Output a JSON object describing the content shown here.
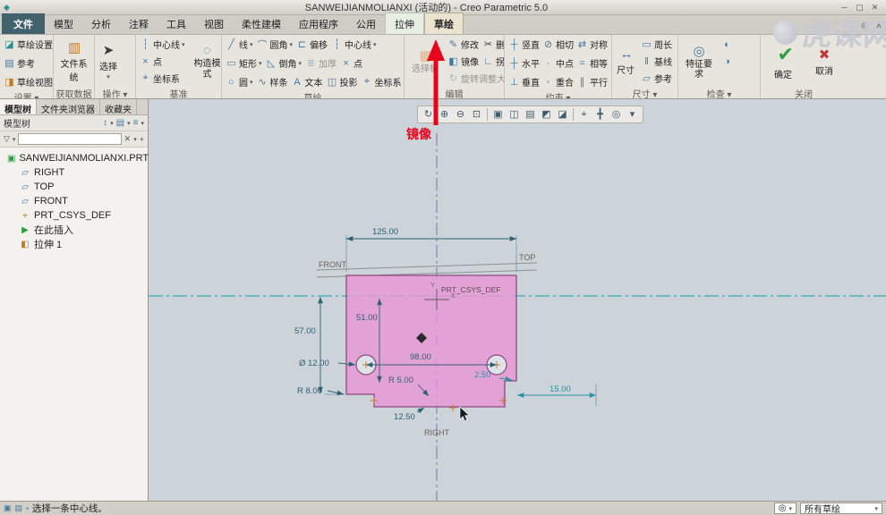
{
  "window": {
    "title": "SANWEIJIANMOLIANXI (活动的) - Creo Parametric 5.0",
    "minimize": "─",
    "maximize": "▢",
    "close": "✕",
    "watermark_text": "虎课网"
  },
  "tabs": {
    "file": "文件",
    "model": "模型",
    "analysis": "分析",
    "annotate": "注释",
    "tools": "工具",
    "view": "视图",
    "flexible": "柔性建模",
    "applications": "应用程序",
    "common": "公用",
    "extrude": "拉伸",
    "sketch": "草绘"
  },
  "ribbon": {
    "setup": {
      "label": "设置 ▾",
      "sketch_setup": "草绘设置",
      "references": "参考",
      "sketch_view": "草绘视图"
    },
    "get_data": {
      "label": "获取数据",
      "file_system": "文件系统"
    },
    "operations": {
      "label": "操作 ▾",
      "select": "选择"
    },
    "datum": {
      "label": "基准",
      "centerline": "中心线",
      "point": "点",
      "csys": "坐标系",
      "construction_mode": "构造模式"
    },
    "sketch": {
      "label": "草绘",
      "line": "线",
      "fillet": "圆角",
      "offset": "偏移",
      "centerline": "中心线",
      "rectangle": "矩形",
      "chamfer": "倒角",
      "thicken": "加厚",
      "point": "点",
      "circle": "圆",
      "spline": "样条",
      "text": "文本",
      "project": "投影",
      "csys": "坐标系"
    },
    "editing": {
      "label": "编辑",
      "palette": "选择板",
      "modify": "修改",
      "delete_segment": "删除段",
      "mirror": "镜像",
      "corner": "拐角",
      "rotate_resize": "旋转调整大小"
    },
    "constrain": {
      "label": "约束 ▾",
      "vertical": "竖直",
      "tangent": "相切",
      "symmetric": "对称",
      "horizontal": "水平",
      "midpoint": "中点",
      "equal": "相等",
      "perpendicular": "垂直",
      "coincident": "重合",
      "parallel": "平行"
    },
    "dimension": {
      "label": "尺寸 ▾",
      "dimension": "尺寸",
      "perimeter": "周长",
      "baseline": "基线",
      "reference": "参考"
    },
    "inspect": {
      "label": "检查 ▾",
      "feature_requirements": "特征要求"
    },
    "close": {
      "label": "关闭",
      "ok": "确定",
      "cancel": "取消"
    }
  },
  "sidebar": {
    "tab_model_tree": "模型树",
    "tab_folder_browser": "文件夹浏览器",
    "tab_favorites": "收藏夹",
    "tree_title": "模型树",
    "items": [
      {
        "label": "SANWEIJIANMOLIANXI.PRT",
        "icon": "part"
      },
      {
        "label": "RIGHT",
        "icon": "plane"
      },
      {
        "label": "TOP",
        "icon": "plane"
      },
      {
        "label": "FRONT",
        "icon": "plane"
      },
      {
        "label": "PRT_CSYS_DEF",
        "icon": "csys"
      },
      {
        "label": "在此插入",
        "icon": "insert"
      },
      {
        "label": "拉伸 1",
        "icon": "extrude"
      }
    ]
  },
  "canvas": {
    "annotation_mirror": "镜像",
    "labels": {
      "front": "FRONT",
      "top": "TOP",
      "right": "RIGHT",
      "csys": "PRT_CSYS_DEF",
      "axis_y": "Y",
      "axis_x": "X"
    },
    "dims": {
      "width": "125.00",
      "height": "57.00",
      "inner_height": "51.00",
      "hole_dia": "Ø 12.00",
      "hole_span": "98.00",
      "corner_radius": "R 8.00",
      "slot_radius": "R 5.00",
      "step": "2.50",
      "edge_offset": "15.00",
      "notch": "12.50"
    }
  },
  "statusbar": {
    "message": "选择一条中心线。",
    "filter_label": "所有草绘"
  },
  "colors": {
    "annotation": "#e8001c",
    "sketch_fill": "#e897d5",
    "sketch_edge": "#8d4a7e",
    "centerline": "#14a2aa",
    "mirror_line": "#7d74a8",
    "dimension": "#2e6072",
    "dimension_weak": "#2a93a3"
  },
  "toolbar_glyphs": [
    "↻",
    "⊕",
    "⊖",
    "⊡",
    "▣",
    "◫",
    "▤",
    "◩",
    "◪",
    "⌖",
    "╋",
    "◎",
    "▾"
  ],
  "glyphs": {
    "app": "◆",
    "search": "◎",
    "collapse": "∧",
    "caret": "▾",
    "sketch_setup": "◪",
    "references": "▤",
    "sketch_view": "◨",
    "file_system": "▥",
    "select": "➤",
    "centerline": "┆",
    "point": "×",
    "csys": "⌖",
    "construction_mode": "◌",
    "line": "╱",
    "fillet": "⌒",
    "offset": "⊏",
    "rectangle": "▭",
    "chamfer": "◺",
    "thicken": "≣",
    "circle": "○",
    "spline": "∿",
    "text": "A",
    "project": "◫",
    "palette": "▦",
    "modify": "✎",
    "delete_segment": "✂",
    "mirror": "◧",
    "corner": "∟",
    "rotate_resize": "↻",
    "vertical": "┼",
    "tangent": "⊘",
    "symmetric": "⇄",
    "horizontal": "┼",
    "midpoint": "∙",
    "equal": "=",
    "perpendicular": "⊥",
    "coincident": "◦",
    "parallel": "∥",
    "dimension": "↔",
    "perimeter": "▭",
    "baseline": "‖",
    "ref_dimension": "▱",
    "feature_requirements": "◎",
    "inspect_open_ends": "◐",
    "inspect_shade_loops": "◑",
    "ok": "✔",
    "cancel": "✖",
    "tree_part": "▣",
    "tree_plane": "▱",
    "tree_csys": "⌖",
    "tree_insert": "▶",
    "tree_extrude": "◧",
    "tree_toggle": "↕",
    "tree_cols": "▤",
    "tree_menu": "≡",
    "funnel": "▽",
    "clear": "✕",
    "plus": "+",
    "status_icon1": "▣",
    "status_icon2": "▤",
    "status_bullet": "▪",
    "status_find": "◎"
  }
}
